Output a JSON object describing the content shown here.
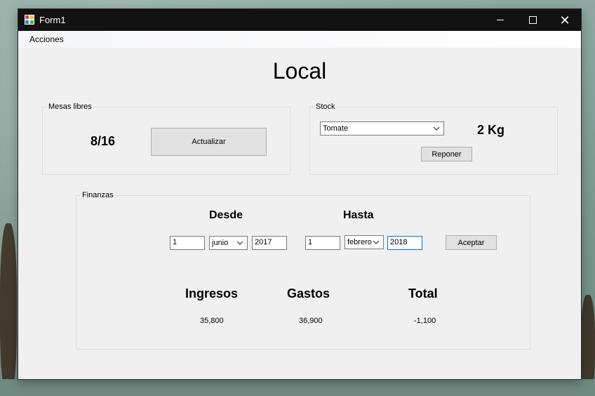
{
  "window": {
    "title": "Form1"
  },
  "menu": {
    "items": [
      "Acciones"
    ]
  },
  "heading": "Local",
  "mesas": {
    "legend": "Mesas libres",
    "count": "8/16",
    "update_button": "Actualizar"
  },
  "stock": {
    "legend": "Stock",
    "product": "Tomate",
    "quantity": "2 Kg",
    "restock_button": "Reponer"
  },
  "finanzas": {
    "legend": "Finanzas",
    "desde": {
      "label": "Desde",
      "day": "1",
      "month": "junio",
      "year": "2017"
    },
    "hasta": {
      "label": "Hasta",
      "day": "1",
      "month": "febrero",
      "year": "2018"
    },
    "accept_button": "Aceptar",
    "ingresos": {
      "label": "Ingresos",
      "value": "35,800"
    },
    "gastos": {
      "label": "Gastos",
      "value": "36,900"
    },
    "total": {
      "label": "Total",
      "value": "-1,100"
    }
  },
  "colors": {
    "accent_focus": "#0078d7",
    "titlebar": "#121212"
  }
}
